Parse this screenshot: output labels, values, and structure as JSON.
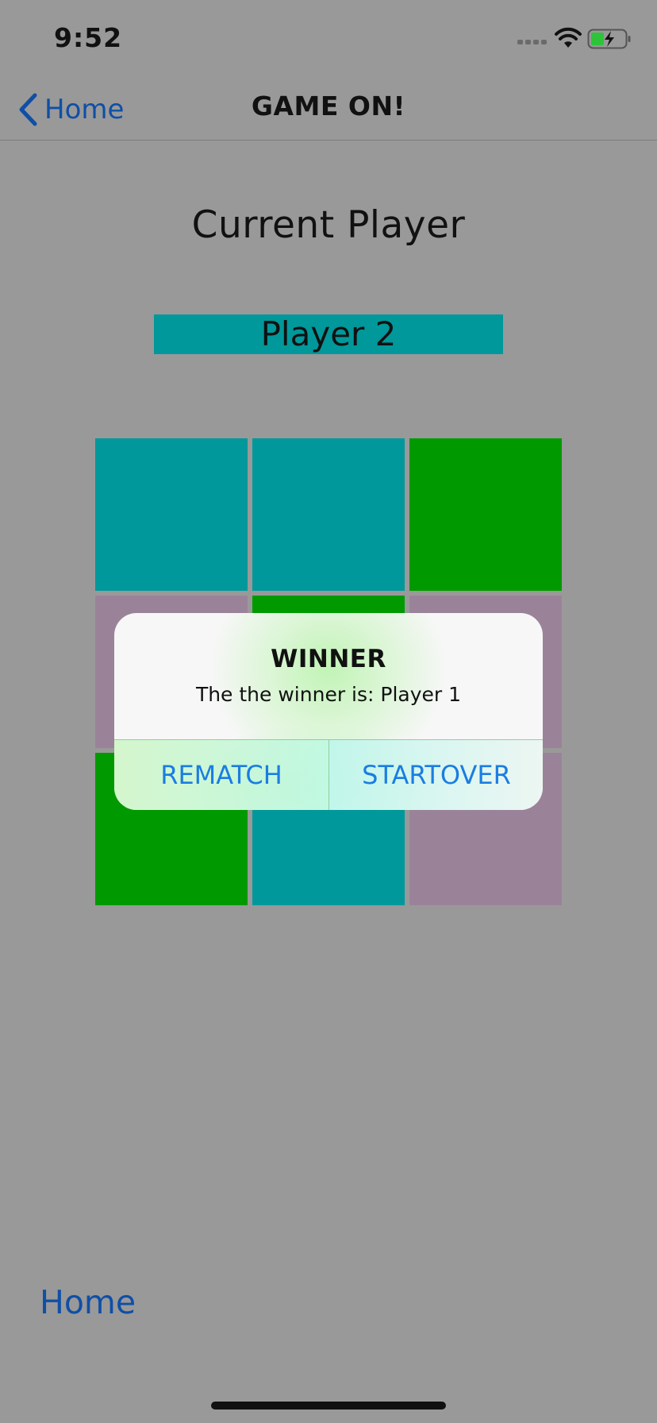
{
  "status_bar": {
    "time": "9:52"
  },
  "nav": {
    "back_label": "Home",
    "title": "GAME ON!"
  },
  "game": {
    "heading": "Current Player",
    "current_player": "Player 2",
    "colors": {
      "teal": "#00989a",
      "green": "#009a00",
      "mauve": "#9a8399"
    },
    "board": [
      [
        "teal",
        "teal",
        "green"
      ],
      [
        "mauve",
        "green",
        "mauve"
      ],
      [
        "green",
        "teal",
        "mauve"
      ]
    ]
  },
  "alert": {
    "title": "WINNER",
    "message": "The the winner is: Player 1",
    "rematch_label": "REMATCH",
    "startover_label": "STARTOVER"
  },
  "footer": {
    "home_label": "Home"
  }
}
